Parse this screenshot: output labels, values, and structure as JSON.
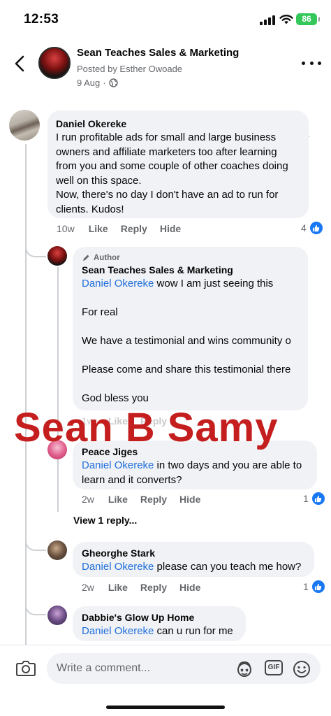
{
  "status_bar": {
    "time": "12:53",
    "battery": "86"
  },
  "post_header": {
    "title": "Sean Teaches Sales & Marketing",
    "posted_by": "Posted by Esther Owoade",
    "date": "9 Aug",
    "date_separator": "·",
    "icons": {
      "back": "chevron-left-icon",
      "more": "more-dots-icon",
      "audience": "globe-icon"
    }
  },
  "actions": {
    "like": "Like",
    "reply": "Reply",
    "hide": "Hide"
  },
  "comments": [
    {
      "name": "Daniel Okereke",
      "text": "I run profitable ads for small and large business\nowners and affiliate marketers too after learning\nfrom you and some couple of other coaches doing\nwell on this space.\nNow, there's no day I don't have an ad to run for\nclients. Kudos!",
      "time": "10w",
      "reactions": "4"
    }
  ],
  "replies": [
    {
      "badge": "Author",
      "name": "Sean Teaches Sales & Marketing",
      "mention": "Daniel Okereke",
      "text": " wow I am just seeing this\n\nFor real\n\nWe have a testimonial and wins community o\n\nPlease come and share this testimonial there\n\nGod bless you",
      "time": "1w",
      "like": "Like",
      "reply": "Reply"
    },
    {
      "name": "Peace Jiges",
      "mention": "Daniel Okereke",
      "text": " in two days and you are able to\nlearn and it converts?",
      "time": "2w",
      "reactions": "1"
    },
    {
      "name": "Gheorghe Stark",
      "mention": "Daniel Okereke",
      "text": " please can you teach me how?",
      "time": "2w",
      "reactions": "1"
    },
    {
      "name": "Dabbie's Glow Up Home",
      "mention": "Daniel Okereke",
      "text": " can u run for me"
    }
  ],
  "view_replies": "View 1 reply...",
  "watermark": "Sean B Samy",
  "composer": {
    "placeholder": "Write a comment...",
    "gif_label": "GIF",
    "icons": {
      "camera": "camera-icon",
      "avatar_sticker": "avatar-sticker-icon",
      "gif": "gif-icon",
      "emoji": "emoji-icon"
    }
  },
  "colors": {
    "link": "#216fdb",
    "like": "#1877f2",
    "bubble": "#f0f2f5",
    "watermark": "#c41e1e",
    "battery": "#34c759"
  }
}
